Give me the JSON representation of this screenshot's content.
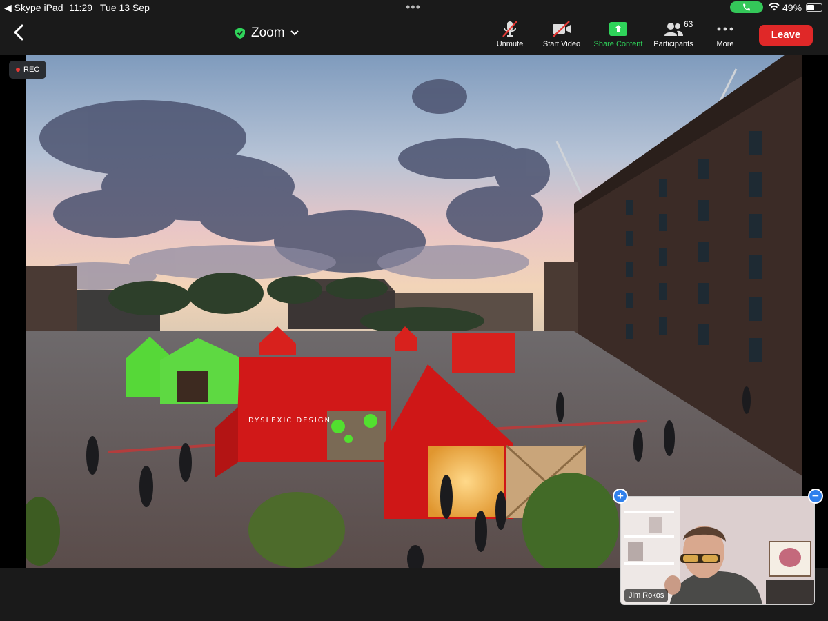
{
  "status_bar": {
    "back_app": "◀ Skype iPad",
    "time": "11:29",
    "date": "Tue 13 Sep",
    "battery": "49%",
    "battery_level": 0.49
  },
  "toolbar": {
    "title": "Zoom",
    "unmute": "Unmute",
    "start_video": "Start Video",
    "share_content": "Share Content",
    "participants": "Participants",
    "participants_count": "63",
    "more": "More",
    "leave": "Leave",
    "icons": [
      "chevron-left-icon",
      "shield-check-icon",
      "chevron-down-icon",
      "microphone-muted-icon",
      "video-camera-off-icon",
      "share-up-arrow-icon",
      "participants-icon",
      "more-dots-icon"
    ]
  },
  "shared": {
    "rec": "REC",
    "installation_sign": "DYSLEXIC DESIGN"
  },
  "video_tile": {
    "name": "Jim Rokos"
  },
  "colors": {
    "toolbar_bg": "#1a1a1a",
    "share_green": "#2fd45a",
    "leave_red": "#e02828",
    "pip_blue": "#2f80ed",
    "rec_dot": "#e53935"
  }
}
